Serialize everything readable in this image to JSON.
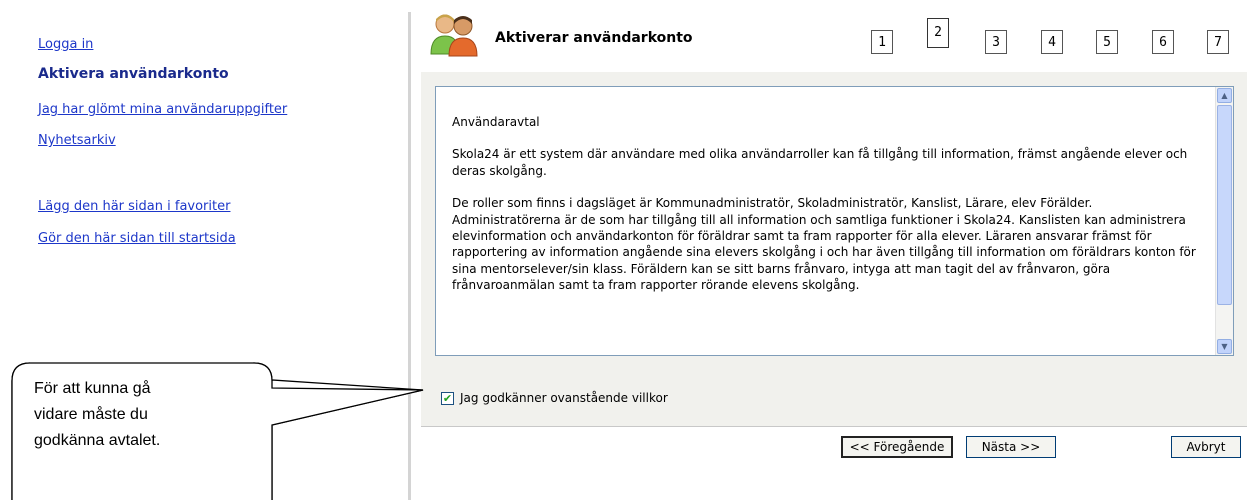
{
  "nav": {
    "login": "Logga in",
    "activate": "Aktivera användarkonto",
    "forgot": "Jag har glömt mina användaruppgifter",
    "news": "Nyhetsarkiv",
    "favorite": "Lägg den här sidan i favoriter",
    "startpage": "Gör den här sidan till startsida"
  },
  "wizard": {
    "icon": "users-icon",
    "title": "Aktiverar användarkonto",
    "steps": [
      "1",
      "2",
      "3",
      "4",
      "5",
      "6",
      "7"
    ],
    "current_step": "2"
  },
  "agreement": {
    "heading": "Användaravtal",
    "p1": "Skola24 är ett system där användare med olika användarroller kan få tillgång till information, främst angående elever och deras skolgång.",
    "p2": "De roller som finns i dagsläget är Kommunadministratör, Skoladministratör, Kanslist, Lärare, elev Förälder. Administratörerna är de som har tillgång till all information och samtliga funktioner i Skola24. Kanslisten kan administrera elevinformation och användarkonton för föräldrar samt ta fram rapporter för alla elever. Läraren ansvarar främst för rapportering av information angående sina elevers skolgång i och har även tillgång till information om föräldrars konton för sina mentorselever/sin klass. Föräldern kan se sitt barns frånvaro, intyga att man tagit del av frånvaron, göra frånvaroanmälan samt ta fram rapporter rörande elevens skolgång.",
    "checkbox_label": "Jag godkänner ovanstående villkor",
    "checkbox_checked": true
  },
  "buttons": {
    "prev": "<< Föregående",
    "next": "Nästa >>",
    "cancel": "Avbryt"
  },
  "callout": {
    "line1": "För att kunna gå",
    "line2": "vidare måste du",
    "line3": "godkänna avtalet."
  }
}
